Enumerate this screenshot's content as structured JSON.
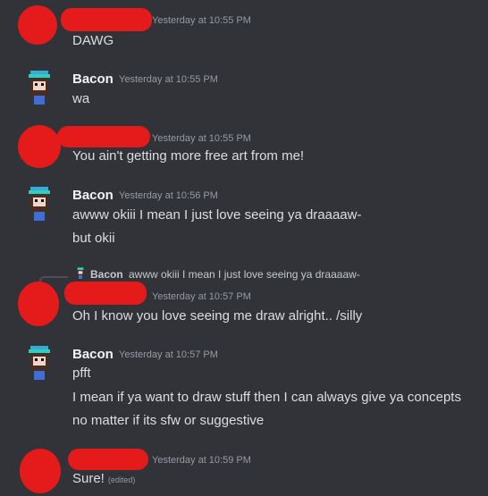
{
  "messages": [
    {
      "time": "Yesterday at 10:55 PM",
      "text": "DAWG"
    },
    {
      "username": "Bacon",
      "time": "Yesterday at 10:55 PM",
      "text": "wa"
    },
    {
      "time": "Yesterday at 10:55 PM",
      "text": "You ain't getting more free art from me!"
    },
    {
      "username": "Bacon",
      "time": "Yesterday at 10:56 PM",
      "lines": [
        "awww okiii I mean I just love seeing ya draaaaw-",
        "but okii"
      ]
    },
    {
      "reply": {
        "username": "Bacon",
        "text": "awww okiii I mean I just love seeing ya draaaaw-"
      },
      "time": "Yesterday at 10:57 PM",
      "text": "Oh I know you love seeing me draw alright.. /silly"
    },
    {
      "username": "Bacon",
      "time": "Yesterday at 10:57 PM",
      "lines": [
        "pfft",
        "I mean if ya want to draw stuff then I can always give ya concepts",
        "no matter if its sfw or suggestive"
      ]
    },
    {
      "time": "Yesterday at 10:59 PM",
      "text": "Sure!",
      "edited": "(edited)"
    }
  ],
  "colors": {
    "background": "#313338",
    "redaction": "#e51a1a",
    "text": "#dbdee1",
    "muted": "#949ba4"
  },
  "icons": {
    "bacon_avatar": "pixel-character-avatar"
  }
}
